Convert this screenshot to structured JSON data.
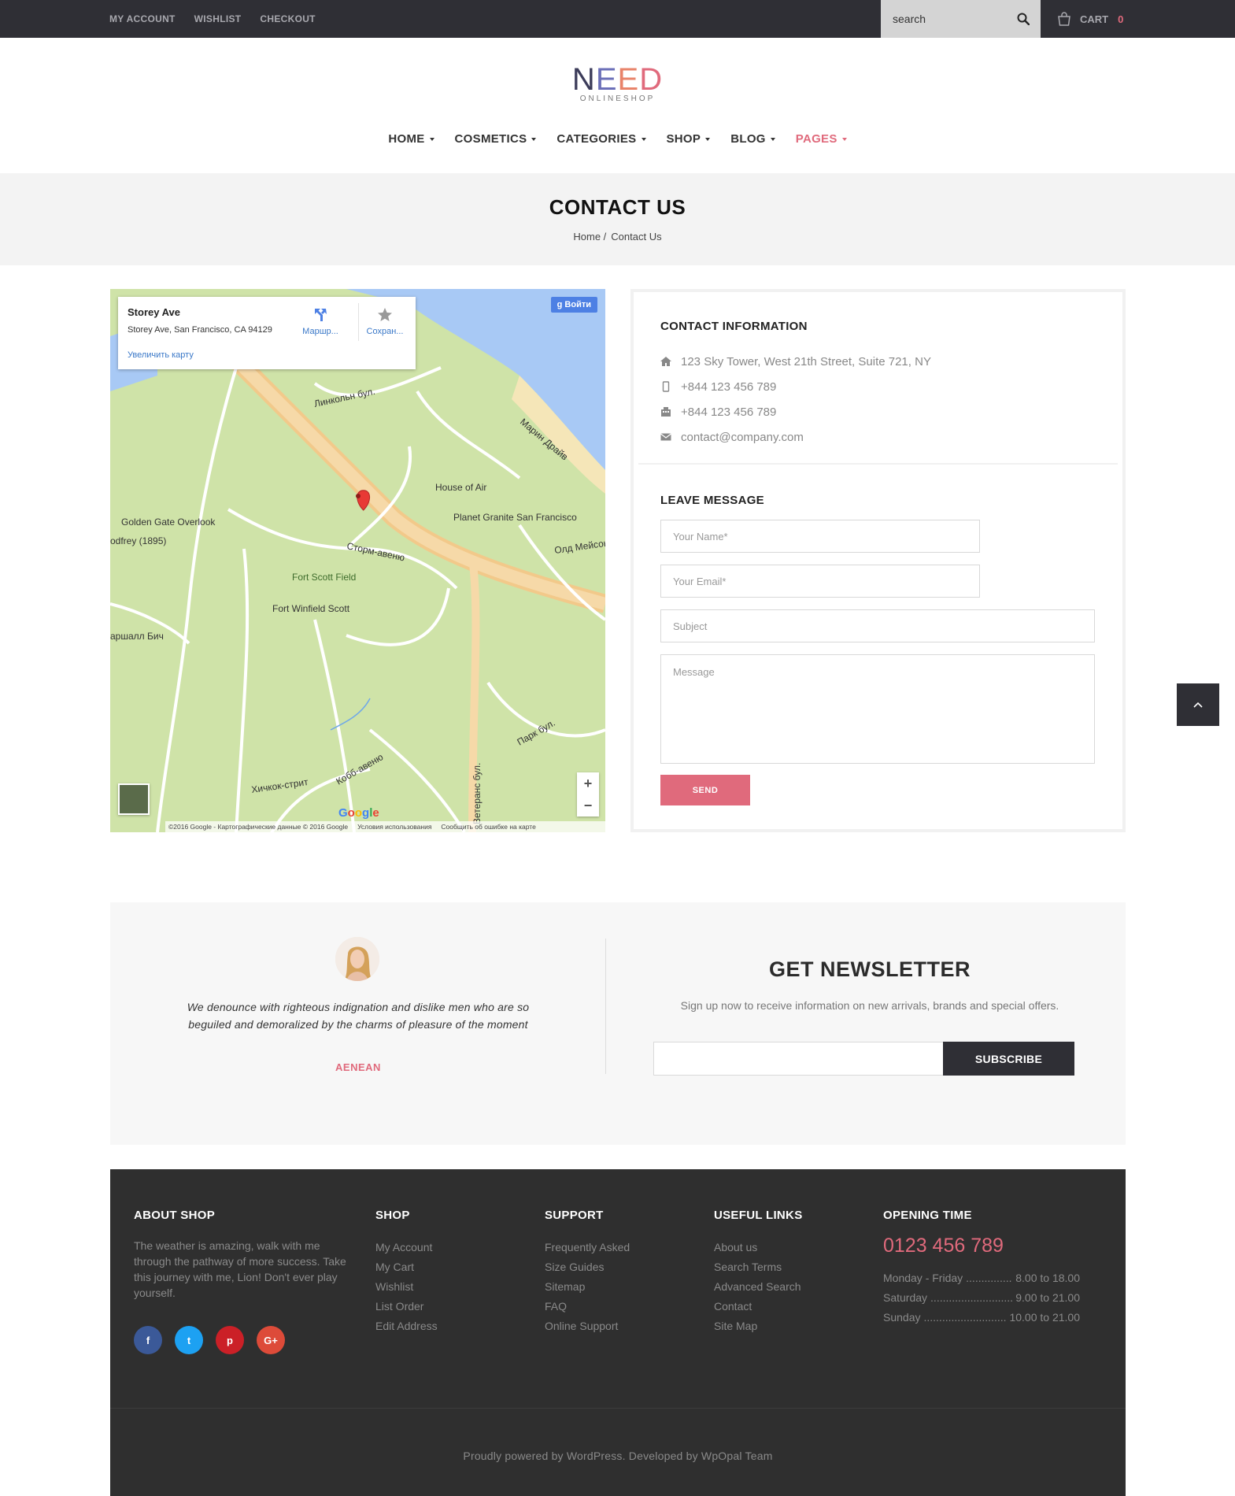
{
  "topbar": {
    "links": [
      "MY ACCOUNT",
      "WISHLIST",
      "CHECKOUT"
    ],
    "search_placeholder": "search",
    "cart_label": "CART",
    "cart_count": "0"
  },
  "logo": {
    "main_letters": [
      "N",
      "E",
      "E",
      "D"
    ],
    "sub": "ONLINESHOP"
  },
  "nav": {
    "items": [
      {
        "label": "HOME",
        "active": false
      },
      {
        "label": "COSMETICS",
        "active": false
      },
      {
        "label": "CATEGORIES",
        "active": false
      },
      {
        "label": "SHOP",
        "active": false
      },
      {
        "label": "BLOG",
        "active": false
      },
      {
        "label": "PAGES",
        "active": true
      }
    ]
  },
  "page": {
    "title": "CONTACT US",
    "breadcrumb": [
      "Home /",
      "Contact Us"
    ]
  },
  "map": {
    "place_name": "Storey Ave",
    "place_address": "Storey Ave, San Francisco, CA 94129",
    "zoom_link": "Увеличить карту",
    "route_label": "Маршр...",
    "save_label": "Сохран...",
    "signin_label": "Войти",
    "zoom_in": "+",
    "zoom_out": "−",
    "google_logo": "Google",
    "footer_items": [
      "©2016 Google - Картографические данные © 2016 Google",
      "Условия использования",
      "Сообщить об ошибке на карте"
    ],
    "labels": [
      "Golden Gate Overlook",
      "odfrey (1895)",
      "House of Air",
      "Planet Granite San Francisco",
      "Fort Scott Field",
      "Fort Winfield Scott",
      "Линкольн бул.",
      "Сторм-авеню",
      "Ветеранс бул.",
      "Кобб-авеню",
      "Хичкок-стрит",
      "Марин Драйв",
      "Парк бул.",
      "Олд Мейсон",
      "аршалл Бич"
    ]
  },
  "contact": {
    "info_title": "CONTACT INFORMATION",
    "address": "123 Sky Tower, West 21th Street, Suite 721, NY",
    "phone": "+844 123 456 789",
    "fax": "+844 123 456 789",
    "email": "contact@company.com",
    "message_title": "LEAVE MESSAGE",
    "name_placeholder": "Your Name*",
    "email_placeholder": "Your Email*",
    "subject_placeholder": "Subject",
    "message_placeholder": "Message",
    "send_label": "SEND"
  },
  "testimonial": {
    "quote": "We denounce with righteous indignation and dislike men who are so beguiled and demoralized by the charms of pleasure of the moment",
    "author": "AENEAN"
  },
  "newsletter": {
    "title": "GET NEWSLETTER",
    "subtitle": "Sign up now to receive information on new arrivals, brands and special offers.",
    "button": "SUBSCRIBE"
  },
  "footer": {
    "about_title": "ABOUT SHOP",
    "about_text": "The weather is amazing, walk with me through the pathway of more success. Take this journey with me, Lion! Don't ever play yourself.",
    "social": [
      {
        "icon": "facebook-icon",
        "glyph": "f",
        "color": "#3b5998"
      },
      {
        "icon": "twitter-icon",
        "glyph": "t",
        "color": "#1da1f2"
      },
      {
        "icon": "pinterest-icon",
        "glyph": "p",
        "color": "#cb2027"
      },
      {
        "icon": "google-plus-icon",
        "glyph": "G+",
        "color": "#dd4b39"
      }
    ],
    "shop_title": "SHOP",
    "shop_links": [
      "My Account",
      "My Cart",
      "Wishlist",
      "List Order",
      "Edit Address"
    ],
    "support_title": "SUPPORT",
    "support_links": [
      "Frequently Asked",
      "Size Guides",
      "Sitemap",
      "FAQ",
      "Online Support"
    ],
    "useful_title": "USEFUL LINKS",
    "useful_links": [
      "About us",
      "Search Terms",
      "Advanced Search",
      "Contact",
      "Site Map"
    ],
    "opening_title": "OPENING TIME",
    "opening_phone": "0123 456 789",
    "hours": [
      {
        "day": "Monday - Friday",
        "time": "8.00 to 18.00"
      },
      {
        "day": "Saturday",
        "time": "9.00 to 21.00"
      },
      {
        "day": "Sunday",
        "time": "10.00 to 21.00"
      }
    ],
    "copyright": "Proudly powered by WordPress. Developed by WpOpal Team"
  },
  "colors": {
    "accent": "#e06a7c",
    "dark": "#2f2f35",
    "footer_bg": "#2f2f2f",
    "band_bg": "#f3f3f3"
  }
}
